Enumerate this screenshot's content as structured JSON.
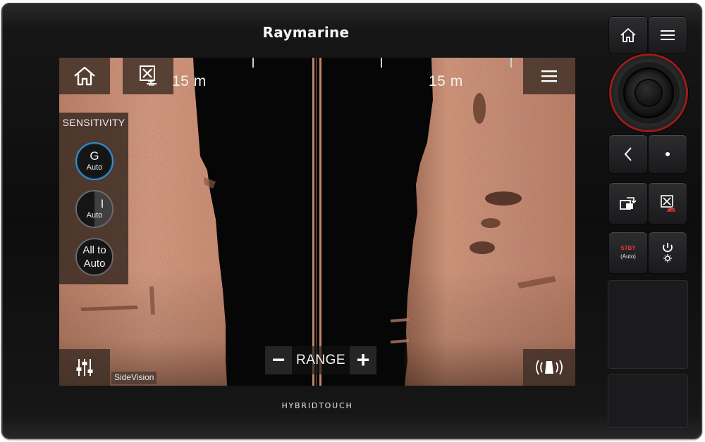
{
  "device": {
    "brand": "Raymarine",
    "model": "HYBRIDTOUCH"
  },
  "screen": {
    "range_left": "15 m",
    "range_right": "15 m",
    "sensitivity": {
      "title": "SENSITIVITY",
      "gain": {
        "main": "G",
        "sub": "Auto"
      },
      "intensity": {
        "main": "I",
        "sub": "Auto"
      },
      "all": {
        "line1": "All to",
        "line2": "Auto"
      }
    },
    "range_control": {
      "minus": "−",
      "label": "RANGE",
      "plus": "+"
    },
    "app_name": "SideVision"
  },
  "hardware_buttons": {
    "stby_line1": "STBY",
    "stby_line2": "(Auto)"
  },
  "colors": {
    "sonar_bright": "#e8a98e",
    "sonar_mid": "#c88266",
    "sonar_dark": "#7a4c38",
    "rotary_accent": "#9c1b1b",
    "knob_active": "#2f8fd0"
  }
}
